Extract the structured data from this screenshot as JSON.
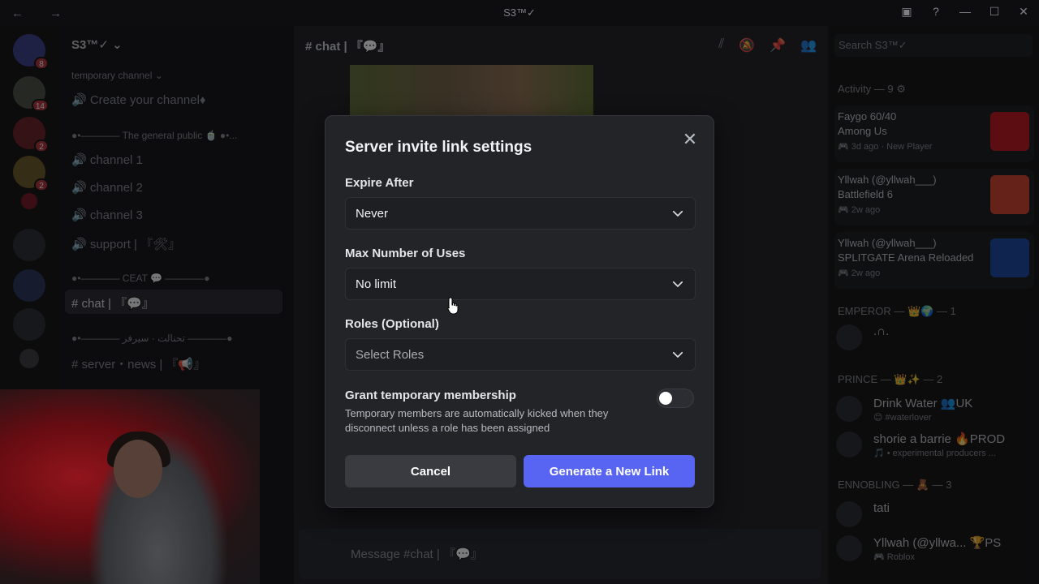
{
  "window": {
    "title": "S3™✓",
    "nav_glyphs": "← →",
    "controls": [
      "▣",
      "?",
      "—",
      "☐",
      "✕"
    ]
  },
  "guilds": {
    "badges": [
      "8",
      "14",
      "2",
      "2"
    ]
  },
  "sidebar": {
    "server_name": "S3™✓ ⌄",
    "categories": [
      "temporary channel ⌄",
      "●•———— The general public 🍵 ●•...",
      "●•———— CEAT 💬 ————●",
      "●•———— تحنالت · سيرفر ————●"
    ],
    "channels": [
      "🔊 Create your channel♦",
      "🔊 channel 1",
      "🔊 channel 2",
      "🔊 channel 3",
      "🔊 support | 『🛠』",
      "# chat | 『💬』",
      "# server・news | 『📢』"
    ]
  },
  "chat": {
    "header": "# chat | 『💬』",
    "composer_placeholder": "Message #chat | 『💬』"
  },
  "members": {
    "search_placeholder": "Search S3™✓",
    "activity_header": "Activity — 9 ⚙",
    "activities": [
      {
        "name": "Faygo 60/40",
        "game": "Among Us",
        "time": "🎮 3d ago · New Player",
        "color": "#c4151c"
      },
      {
        "name": "Yllwah (@yllwah___)",
        "game": "Battlefield 6",
        "time": "🎮 2w ago",
        "color": "#d8442c"
      },
      {
        "name": "Yllwah (@yllwah___)",
        "game": "SPLITGATE Arena Reloaded",
        "time": "🎮 2w ago",
        "color": "#1a4aa8"
      }
    ],
    "groups": [
      {
        "header": "EMPEROR — 👑🌍 — 1",
        "members": [
          {
            "name": ".∩.",
            "status": ""
          }
        ]
      },
      {
        "header": "PRINCE — 👑✨ — 2",
        "members": [
          {
            "name": "Drink Water 👥UK",
            "status": "😊 #waterlover"
          },
          {
            "name": "shorie a barrie 🔥PROD",
            "status": "🎵 • experimental producers ..."
          }
        ]
      },
      {
        "header": "ENNOBLING — 🧸 — 3",
        "members": [
          {
            "name": "tati",
            "status": ""
          },
          {
            "name": "Yllwah (@yllwa... 🏆PS",
            "status": "🎮 Roblox"
          }
        ]
      }
    ]
  },
  "modal": {
    "title": "Server invite link settings",
    "expire_label": "Expire After",
    "expire_value": "Never",
    "max_uses_label": "Max Number of Uses",
    "max_uses_value": "No limit",
    "roles_label": "Roles (Optional)",
    "roles_placeholder": "Select Roles",
    "grant_label": "Grant temporary membership",
    "grant_help": "Temporary members are automatically kicked when they disconnect unless a role has been assigned",
    "grant_enabled": false,
    "cancel_label": "Cancel",
    "generate_label": "Generate a New Link",
    "close_glyph": "✕"
  },
  "colors": {
    "accent": "#5865f2",
    "modal_bg": "#232428",
    "input_bg": "#1e1f22"
  }
}
